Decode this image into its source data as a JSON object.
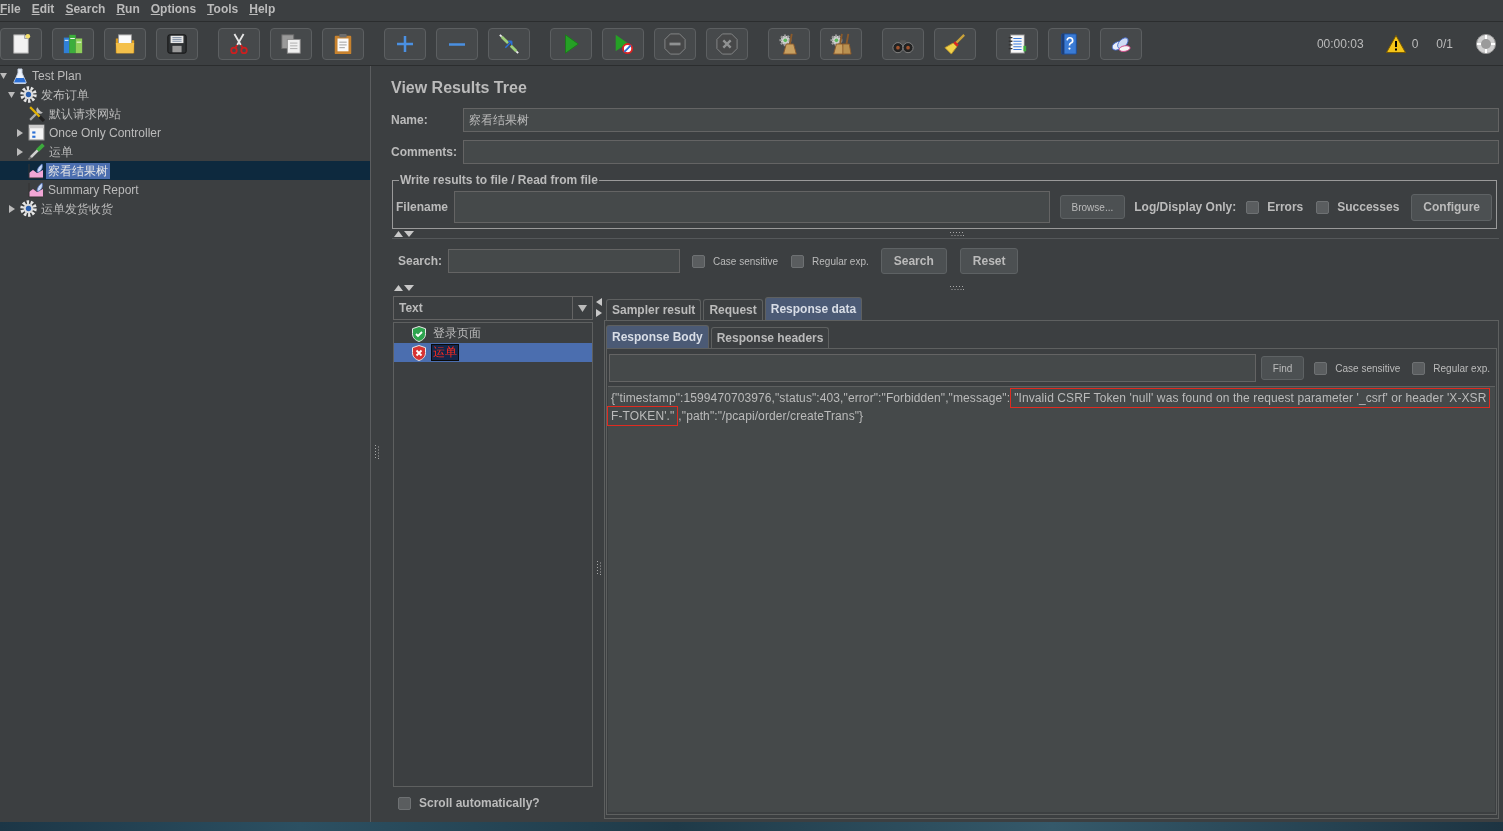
{
  "menu": [
    "File",
    "Edit",
    "Search",
    "Run",
    "Options",
    "Tools",
    "Help"
  ],
  "toolbar": {
    "groups": [
      [
        {
          "kind": "new",
          "disabled": false
        },
        {
          "kind": "templates",
          "disabled": false
        },
        {
          "kind": "open",
          "disabled": false
        },
        {
          "kind": "save",
          "disabled": false
        }
      ],
      [
        {
          "kind": "cut",
          "disabled": false
        },
        {
          "kind": "copy",
          "disabled": false
        },
        {
          "kind": "paste",
          "disabled": false
        }
      ],
      [
        {
          "kind": "expand",
          "disabled": false
        },
        {
          "kind": "collapse",
          "disabled": false
        },
        {
          "kind": "toggle",
          "disabled": false
        }
      ],
      [
        {
          "kind": "start",
          "disabled": false
        },
        {
          "kind": "startnopause",
          "disabled": false
        },
        {
          "kind": "stop",
          "disabled": true
        },
        {
          "kind": "shutdown",
          "disabled": true
        }
      ],
      [
        {
          "kind": "clear",
          "disabled": false
        },
        {
          "kind": "clearall",
          "disabled": false
        }
      ],
      [
        {
          "kind": "search",
          "disabled": false
        },
        {
          "kind": "reset",
          "disabled": false
        }
      ],
      [
        {
          "kind": "log",
          "disabled": false
        },
        {
          "kind": "help",
          "disabled": false
        },
        {
          "kind": "remote",
          "disabled": false
        }
      ]
    ],
    "timer": "00:00:03",
    "warning_count": "0",
    "threads": "0/1"
  },
  "tree": [
    {
      "label": "Test Plan",
      "kind": "plan",
      "expanded": true,
      "selected": false,
      "children": [
        {
          "label": "发布订单",
          "kind": "threadgroup",
          "expanded": true,
          "selected": false,
          "children": [
            {
              "label": "默认请求网站",
              "kind": "config",
              "selected": false
            },
            {
              "label": "Once Only Controller",
              "kind": "controller",
              "expanded": false,
              "selected": false
            },
            {
              "label": "运单",
              "kind": "sampler",
              "expanded": false,
              "selected": false
            },
            {
              "label": "察看结果树",
              "kind": "listener",
              "selected": true
            },
            {
              "label": "Summary Report",
              "kind": "listener",
              "selected": false
            }
          ]
        },
        {
          "label": "运单发货收货",
          "kind": "threadgroup",
          "expanded": false,
          "selected": false
        }
      ]
    }
  ],
  "editor": {
    "title": "View Results Tree",
    "name": {
      "label": "Name:",
      "value": "察看结果树"
    },
    "comments": {
      "label": "Comments:"
    },
    "file_section": {
      "legend": "Write results to file / Read from file",
      "filename_label": "Filename",
      "browse_button": "Browse...",
      "log_label": "Log/Display Only:",
      "options": [
        {
          "label": "Errors",
          "checked": false
        },
        {
          "label": "Successes",
          "checked": false
        }
      ],
      "configure_button": "Configure"
    },
    "search": {
      "label": "Search:",
      "options": [
        {
          "label": "Case sensitive",
          "checked": false
        },
        {
          "label": "Regular exp.",
          "checked": false
        }
      ],
      "buttons": [
        "Search",
        "Reset"
      ]
    },
    "results": {
      "renderer": "Text",
      "items": [
        {
          "label": "登录页面",
          "kind": "success",
          "selected": false
        },
        {
          "label": "运单",
          "kind": "error",
          "selected": true
        }
      ],
      "scroll_option": {
        "label": "Scroll automatically?",
        "checked": false
      }
    },
    "tabs": [
      {
        "label": "Sampler result",
        "selected": false
      },
      {
        "label": "Request",
        "selected": false
      },
      {
        "label": "Response data",
        "selected": true
      }
    ],
    "subtabs": [
      {
        "label": "Response Body",
        "selected": true
      },
      {
        "label": "Response headers",
        "selected": false
      }
    ],
    "find": {
      "button": "Find",
      "options": [
        {
          "label": "Case sensitive",
          "checked": false
        },
        {
          "label": "Regular exp.",
          "checked": false
        }
      ]
    },
    "response_lines": [
      [
        {
          "text": "{\"timestamp\":1599470703976,\"status\":403,\"error\":\"Forbidden\",\"message\":",
          "highlighted": false
        },
        {
          "text": "\"Invalid CSRF Token 'null' was found on the request parameter '_csrf' or header 'X-XSR",
          "highlighted": true
        }
      ],
      [
        {
          "text": "F-TOKEN'.\"",
          "highlighted": true
        },
        {
          "text": ",\"path\":\"/pcapi/order/createTrans\"}",
          "highlighted": false
        }
      ]
    ]
  }
}
